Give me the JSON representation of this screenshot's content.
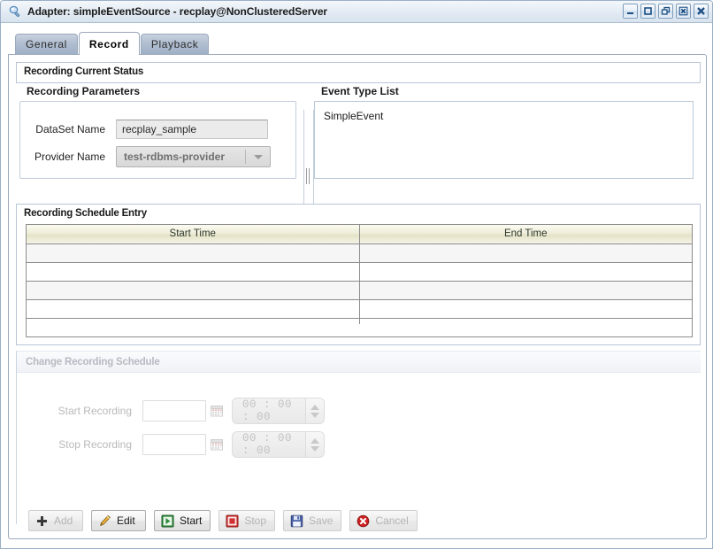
{
  "window": {
    "title": "Adapter: simpleEventSource - recplay@NonClusteredServer",
    "icon": "adapter-icon",
    "controls": [
      {
        "name": "minimize-button",
        "glyph": "minimize"
      },
      {
        "name": "maximize-button",
        "glyph": "maximize"
      },
      {
        "name": "restore-button",
        "glyph": "restore"
      },
      {
        "name": "close-document-button",
        "glyph": "close-box"
      },
      {
        "name": "close-window-button",
        "glyph": "close-x"
      }
    ]
  },
  "tabs": [
    {
      "label": "General",
      "active": false
    },
    {
      "label": "Record",
      "active": true
    },
    {
      "label": "Playback",
      "active": false
    }
  ],
  "status_group": {
    "title": "Recording Current Status"
  },
  "recording_parameters": {
    "section_label": "Recording Parameters",
    "dataset": {
      "label": "DataSet Name",
      "value": "recplay_sample",
      "placeholder": ""
    },
    "provider": {
      "label": "Provider Name",
      "value": "test-rdbms-provider",
      "options": [
        "test-rdbms-provider"
      ]
    }
  },
  "event_type_list": {
    "section_label": "Event Type List",
    "items": [
      "SimpleEvent"
    ]
  },
  "schedule_entry": {
    "title": "Recording Schedule Entry",
    "columns": [
      "Start Time",
      "End Time"
    ],
    "rows": [
      [
        "",
        ""
      ],
      [
        "",
        ""
      ],
      [
        "",
        ""
      ],
      [
        "",
        ""
      ]
    ]
  },
  "change_schedule": {
    "title": "Change Recording Schedule",
    "enabled": false,
    "start": {
      "label": "Start Recording",
      "date_value": "",
      "date_placeholder": "",
      "time_value": "00 : 00 : 00",
      "calendar_icon": "calendar-icon"
    },
    "stop": {
      "label": "Stop Recording",
      "date_value": "",
      "date_placeholder": "",
      "time_value": "00 : 00 : 00",
      "calendar_icon": "calendar-icon"
    }
  },
  "buttons": [
    {
      "label": "Add",
      "icon": "plus-icon",
      "enabled": false
    },
    {
      "label": "Edit",
      "icon": "pencil-icon",
      "enabled": true
    },
    {
      "label": "Start",
      "icon": "play-icon",
      "enabled": true
    },
    {
      "label": "Stop",
      "icon": "stop-icon",
      "enabled": false
    },
    {
      "label": "Save",
      "icon": "floppy-icon",
      "enabled": false
    },
    {
      "label": "Cancel",
      "icon": "cancel-icon",
      "enabled": false
    }
  ],
  "colors": {
    "titlebar_gradient_top": "#f3f7fb",
    "titlebar_gradient_bottom": "#d8e3ee",
    "tab_inactive": "#b3c0d2",
    "table_header": "#eeedd8",
    "accent_border": "#9aa9bb",
    "disabled_text": "#b9b9b9"
  }
}
